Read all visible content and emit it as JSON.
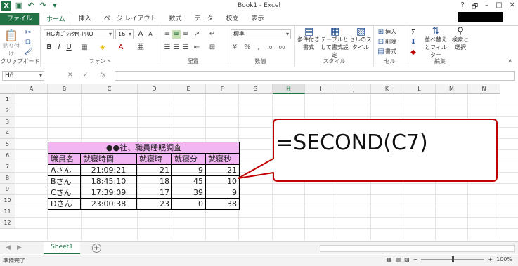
{
  "window": {
    "title": "Book1 - Excel",
    "controls": [
      "?",
      "🗗",
      "–",
      "□",
      "✕"
    ]
  },
  "tabs": [
    {
      "label": "ファイル"
    },
    {
      "label": "ホーム"
    },
    {
      "label": "挿入"
    },
    {
      "label": "ページ レイアウト"
    },
    {
      "label": "数式"
    },
    {
      "label": "データ"
    },
    {
      "label": "校閲"
    },
    {
      "label": "表示"
    }
  ],
  "active_tab": "ホーム",
  "ribbon": {
    "clipboard": {
      "paste": "貼り付け",
      "label": "クリップボード"
    },
    "font": {
      "name": "HG丸ｺﾞｼｯｸM-PRO",
      "size": "16",
      "label": "フォント"
    },
    "alignment": {
      "label": "配置"
    },
    "number": {
      "format": "標準",
      "label": "数値"
    },
    "styles": {
      "conditional": "条件付き書式",
      "table": "テーブルとして書式設定",
      "cell": "セルのスタイル",
      "label": "スタイル"
    },
    "cells": {
      "insert": "挿入",
      "delete": "削除",
      "format": "書式",
      "label": "セル"
    },
    "editing": {
      "sort": "並べ替えとフィルター",
      "find": "検索と選択",
      "label": "編集"
    }
  },
  "formula_bar": {
    "name_box": "H6",
    "cancel": "✕",
    "enter": "✓",
    "fx": "fx",
    "content": ""
  },
  "columns": [
    "A",
    "B",
    "C",
    "D",
    "E",
    "F",
    "G",
    "H",
    "I",
    "J",
    "K",
    "L",
    "M",
    "N"
  ],
  "selected_column": "H",
  "rows": [
    "1",
    "2",
    "3",
    "4",
    "5",
    "6",
    "7",
    "8",
    "9",
    "10",
    "11",
    "12"
  ],
  "table": {
    "title": "●●社、職員睡眠調査",
    "headers": [
      "職員名",
      "就寝時間",
      "就寝時",
      "就寝分",
      "就寝秒"
    ],
    "rows": [
      [
        "Aさん",
        "21:09:21",
        "21",
        "9",
        "21"
      ],
      [
        "Bさん",
        "18:45:10",
        "18",
        "45",
        "10"
      ],
      [
        "Cさん",
        "17:39:09",
        "17",
        "39",
        "9"
      ],
      [
        "Dさん",
        "23:00:38",
        "23",
        "0",
        "38"
      ]
    ]
  },
  "callout": {
    "text": "=SECOND(C7)"
  },
  "sheet_tabs": [
    {
      "label": "Sheet1"
    }
  ],
  "status": {
    "text": "準備完了",
    "zoom": "100%"
  },
  "colors": {
    "excel_green": "#217346",
    "header_fill": "#f2b6f2",
    "callout_border": "#c00000"
  }
}
